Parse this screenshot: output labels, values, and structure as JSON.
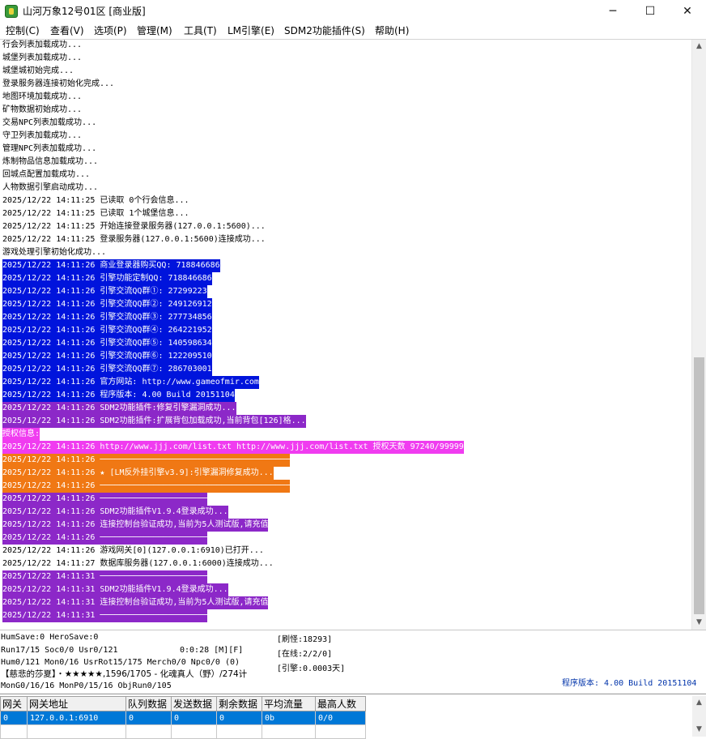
{
  "window": {
    "title": "山河万象12号01区 [商业版]",
    "buttons": {
      "minimize": "─",
      "maximize": "☐",
      "close": "✕"
    }
  },
  "menu": [
    "控制(C)",
    "查看(V)",
    "选项(P)",
    "管理(M)",
    "工具(T)",
    "LM引擎(E)",
    "SDM2功能插件(S)",
    "帮助(H)"
  ],
  "colors": {
    "blue": "#0014dc",
    "purple": "#8c28c8",
    "magenta": "#f03cf0",
    "orange": "#f07814",
    "selection": "#0078d7",
    "version_text": "#0033aa"
  },
  "log": [
    {
      "text": "行会列表加载成功...",
      "style": "none"
    },
    {
      "text": "城堡列表加载成功...",
      "style": "none"
    },
    {
      "text": "城堡城初始完成...",
      "style": "none"
    },
    {
      "text": "登录服务器连接初始化完成...",
      "style": "none"
    },
    {
      "text": "地图环境加载成功...",
      "style": "none"
    },
    {
      "text": "矿物数据初始成功...",
      "style": "none"
    },
    {
      "text": "交易NPC列表加载成功...",
      "style": "none"
    },
    {
      "text": "守卫列表加载成功...",
      "style": "none"
    },
    {
      "text": "管理NPC列表加载成功...",
      "style": "none"
    },
    {
      "text": "炼制物品信息加载成功...",
      "style": "none"
    },
    {
      "text": "回城点配置加载成功...",
      "style": "none"
    },
    {
      "text": "人物数据引擎启动成功...",
      "style": "none"
    },
    {
      "text": "2025/12/22 14:11:25 已读取 0个行会信息...",
      "style": "none"
    },
    {
      "text": "2025/12/22 14:11:25 已读取 1个城堡信息...",
      "style": "none"
    },
    {
      "text": "2025/12/22 14:11:25 开始连接登录服务器(127.0.0.1:5600)...",
      "style": "none"
    },
    {
      "text": "2025/12/22 14:11:25 登录服务器(127.0.0.1:5600)连接成功...",
      "style": "none"
    },
    {
      "text": "游戏处理引擎初始化成功...",
      "style": "none"
    },
    {
      "text": "2025/12/22 14:11:26 商业登录器购买QQ: 718846686",
      "style": "blue"
    },
    {
      "text": "2025/12/22 14:11:26 引擎功能定制QQ: 718846686",
      "style": "blue"
    },
    {
      "text": "2025/12/22 14:11:26 引擎交流QQ群①: 27299223",
      "style": "blue"
    },
    {
      "text": "2025/12/22 14:11:26 引擎交流QQ群②: 249126912",
      "style": "blue"
    },
    {
      "text": "2025/12/22 14:11:26 引擎交流QQ群③: 277734856",
      "style": "blue"
    },
    {
      "text": "2025/12/22 14:11:26 引擎交流QQ群④: 264221952",
      "style": "blue"
    },
    {
      "text": "2025/12/22 14:11:26 引擎交流QQ群⑤: 140598634",
      "style": "blue"
    },
    {
      "text": "2025/12/22 14:11:26 引擎交流QQ群⑥: 122209510",
      "style": "blue"
    },
    {
      "text": "2025/12/22 14:11:26 引擎交流QQ群⑦: 286703001",
      "style": "blue"
    },
    {
      "text": "2025/12/22 14:11:26 官方网站: http://www.gameofmir.com",
      "style": "blue"
    },
    {
      "text": "2025/12/22 14:11:26 程序版本: 4.00 Build 20151104",
      "style": "blue"
    },
    {
      "text": "2025/12/22 14:11:26 SDM2功能插件:修复引擎漏洞成功...",
      "style": "purple"
    },
    {
      "text": "2025/12/22 14:11:26 SDM2功能插件:扩展背包加载成功,当前背包[126]格...",
      "style": "purple"
    },
    {
      "text": "授权信息:",
      "style": "magenta"
    },
    {
      "text": "2025/12/22 14:11:26 http://www.jjj.com/list.txt http://www.jjj.com/list.txt 授权天数 97240/99999",
      "style": "magenta"
    },
    {
      "text": "2025/12/22 14:11:26 ───────────────────────────────────────",
      "style": "orange"
    },
    {
      "text": "2025/12/22 14:11:26 ★ [LM反外挂引擎v3.9]:引擎漏洞修复成功...",
      "style": "orange"
    },
    {
      "text": "2025/12/22 14:11:26 ───────────────────────────────────────",
      "style": "orange"
    },
    {
      "text": "2025/12/22 14:11:26 ──────────────────────",
      "style": "purple"
    },
    {
      "text": "2025/12/22 14:11:26 SDM2功能插件V1.9.4登录成功...",
      "style": "purple"
    },
    {
      "text": "2025/12/22 14:11:26 连接控制台验证成功,当前为5人测试版,请充值",
      "style": "purple"
    },
    {
      "text": "2025/12/22 14:11:26 ──────────────────────",
      "style": "purple"
    },
    {
      "text": "2025/12/22 14:11:26 游戏网关[0](127.0.0.1:6910)已打开...",
      "style": "none"
    },
    {
      "text": "2025/12/22 14:11:27 数据库服务器(127.0.0.1:6000)连接成功...",
      "style": "none"
    },
    {
      "text": "2025/12/22 14:11:31 ──────────────────────",
      "style": "purple"
    },
    {
      "text": "2025/12/22 14:11:31 SDM2功能插件V1.9.4登录成功...",
      "style": "purple"
    },
    {
      "text": "2025/12/22 14:11:31 连接控制台验证成功,当前为5人测试版,请充值",
      "style": "purple"
    },
    {
      "text": "2025/12/22 14:11:31 ──────────────────────",
      "style": "purple"
    }
  ],
  "status": {
    "line1": "HumSave:0 HeroSave:0",
    "line2": "Run17/15 Soc0/0 Usr0/121",
    "line2b": "0:0:28 [M][F]",
    "line3": "Hum0/121 Mon0/16 UsrRot15/175 Merch0/0 Npc0/0 (0)",
    "line4": "【慈悲的莎夏】・★★★★★,1596/1705 - 化魂真人（野）/274计",
    "line5": "MonG0/16/16 MonP0/15/16 ObjRun0/105",
    "refresh": "[刷怪:18293]",
    "online": "[在线:2/2/0]",
    "engine": "[引擎:0.0003天]",
    "version": "程序版本: 4.00 Build 20151104"
  },
  "grid": {
    "columns": [
      "网关",
      "网关地址",
      "队列数据",
      "发送数据",
      "剩余数据",
      "平均流量",
      "最高人数"
    ],
    "rows": [
      [
        "0",
        "127.0.0.1:6910",
        "0",
        "0",
        "0",
        "0b",
        "0/0"
      ]
    ]
  }
}
